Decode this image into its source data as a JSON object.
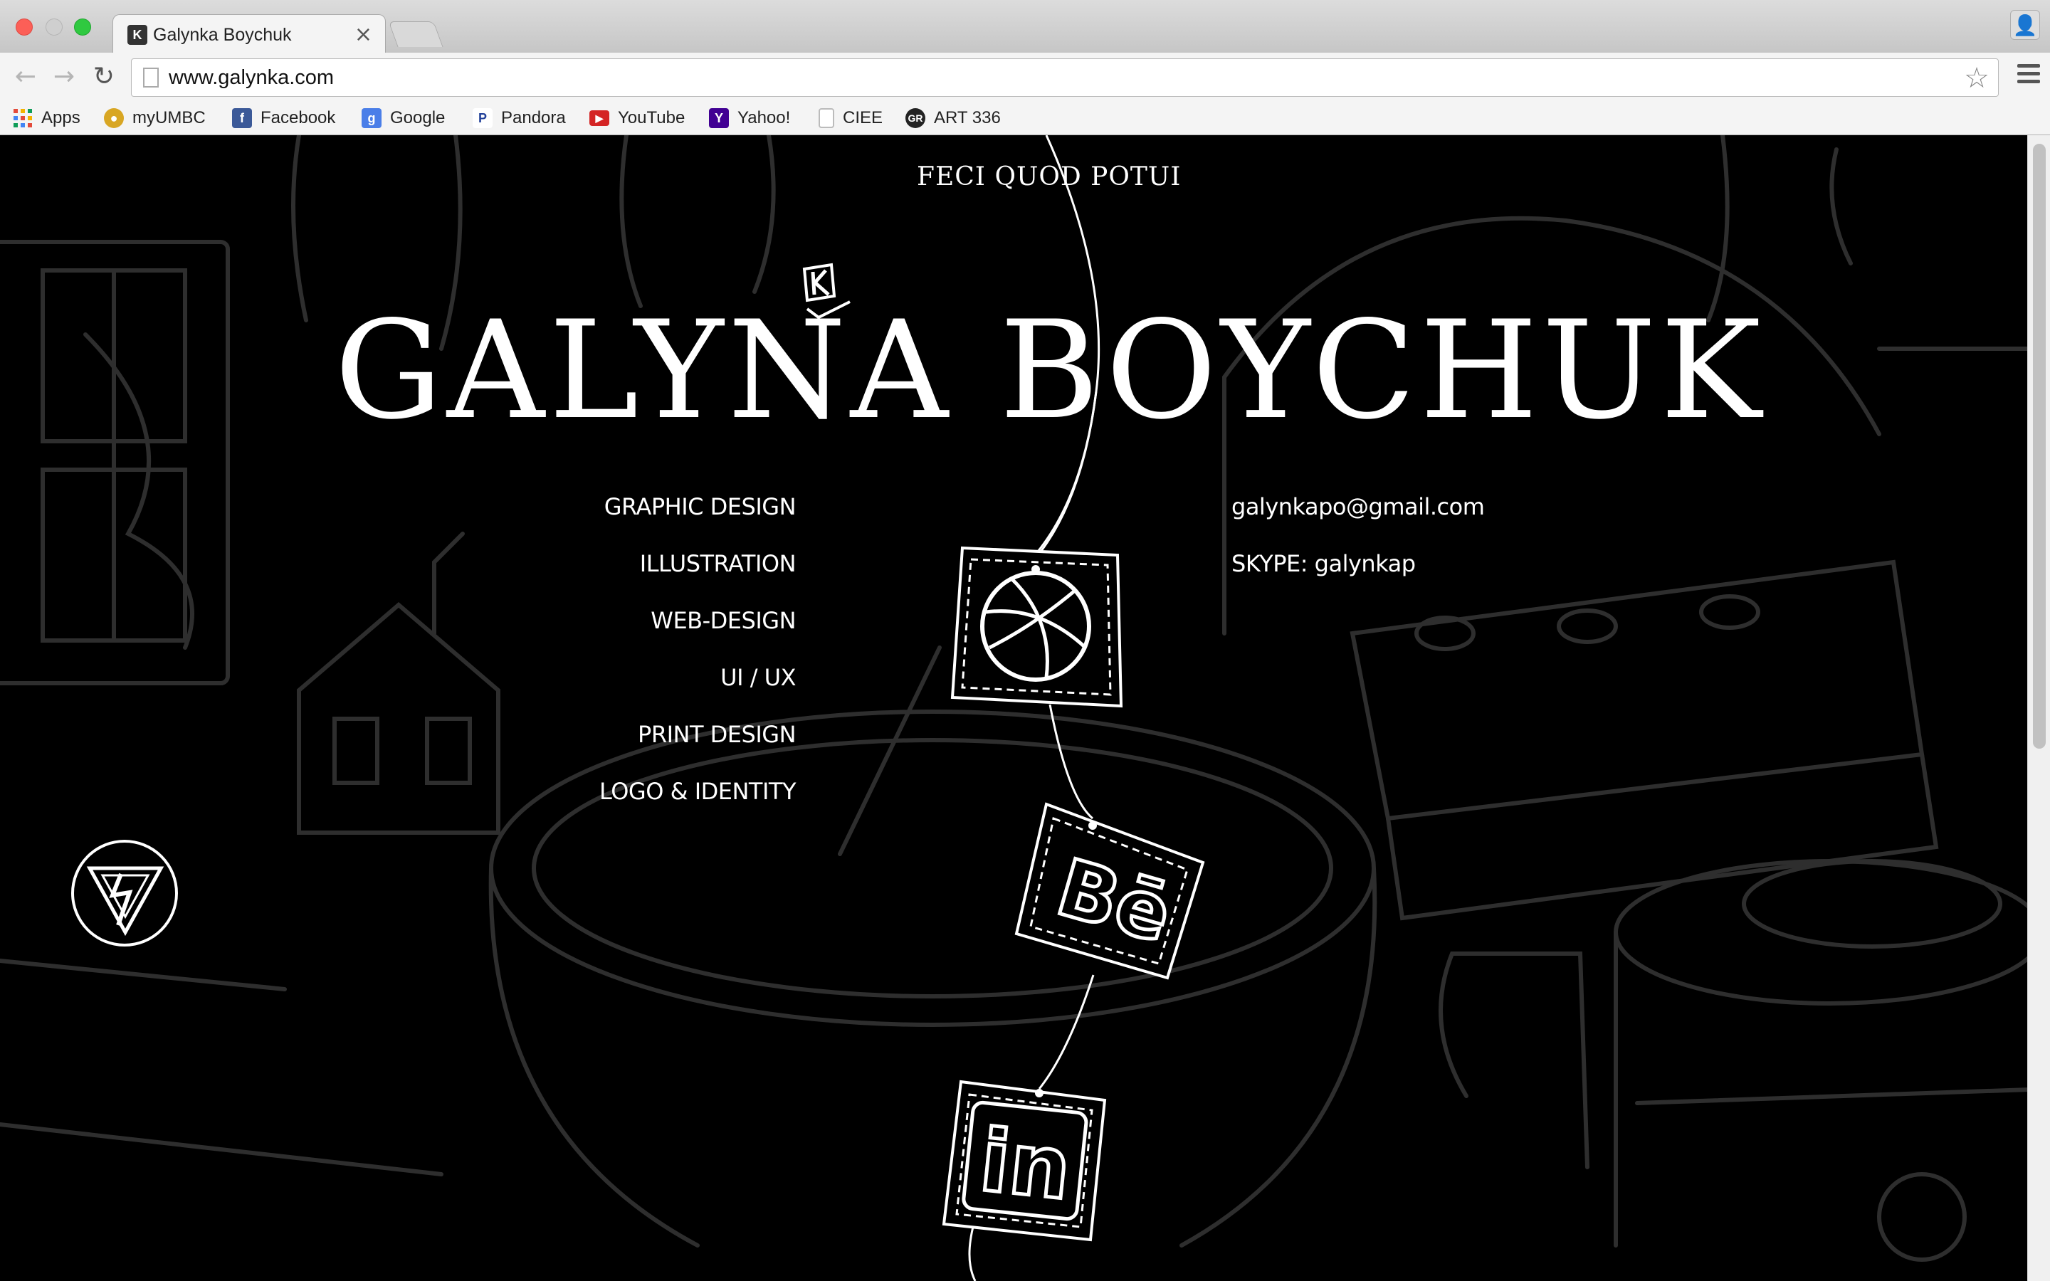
{
  "browser": {
    "tab_title": "Galynka Boychuk",
    "url": "www.galynka.com",
    "bookmarks": [
      {
        "label": "Apps",
        "icon": "apps-grid-icon",
        "color": "#e34a3a"
      },
      {
        "label": "myUMBC",
        "icon": "paw-icon",
        "color": "#d8a623"
      },
      {
        "label": "Facebook",
        "icon": "facebook-icon",
        "color": "#3b5998"
      },
      {
        "label": "Google",
        "icon": "google-icon",
        "color": "#4a7ee8"
      },
      {
        "label": "Pandora",
        "icon": "pandora-icon",
        "color": "#224099"
      },
      {
        "label": "YouTube",
        "icon": "youtube-icon",
        "color": "#d42424"
      },
      {
        "label": "Yahoo!",
        "icon": "yahoo-icon",
        "color": "#410093"
      },
      {
        "label": "CIEE",
        "icon": "page-icon",
        "color": "#cccccc"
      },
      {
        "label": "ART 336",
        "icon": "gr-icon",
        "color": "#222222"
      }
    ]
  },
  "page": {
    "motto": "FECI QUOD POTUI",
    "title": "GALYNA BOYCHUK",
    "services": [
      "GRAPHIC DESIGN",
      "ILLUSTRATION",
      "WEB-DESIGN",
      "UI / UX",
      "PRINT DESIGN",
      "LOGO & IDENTITY"
    ],
    "contact": {
      "email": "galynkapo@gmail.com",
      "skype": "SKYPE: galynkap"
    },
    "social": [
      "dribbble-icon",
      "behance-icon",
      "linkedin-icon"
    ],
    "colors": {
      "background": "#000000",
      "text": "#ffffff",
      "sketch": "#2e2e2e"
    }
  }
}
